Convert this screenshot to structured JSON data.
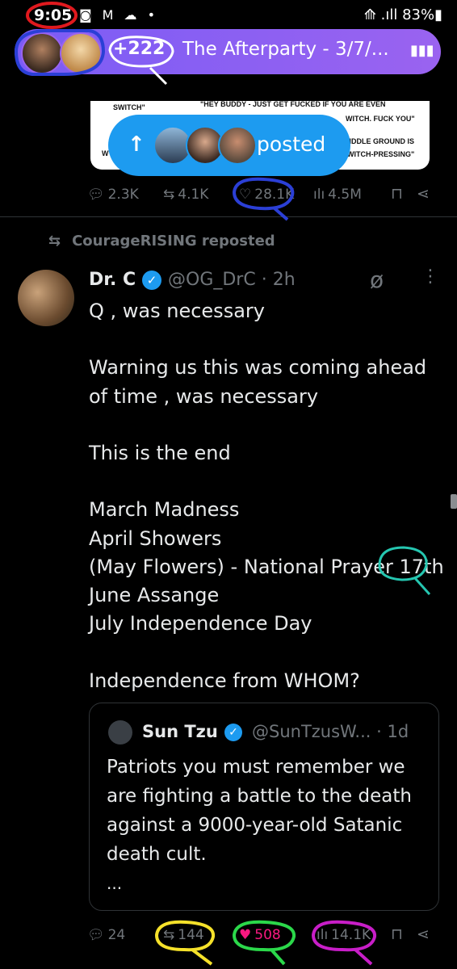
{
  "status_bar": {
    "time": "9:05",
    "icons": "◙ M ☁ •",
    "right": "⟰ .ıll 83%▮"
  },
  "space": {
    "listener_count": "+222",
    "title": "The Afterparty - 3/7/...",
    "audio_icon": "audio-bars-icon"
  },
  "image_card": {
    "line1a": "SWITCH\"",
    "line1b": "\"HEY BUDDY - JUST GET FUCKED IF YOU ARE EVEN",
    "line2": "WITCH. FUCK YOU\"",
    "line3": "IIDDLE GROUND IS",
    "line4a": "W",
    "line4b": "WITCH-PRESSING\""
  },
  "new_posts": {
    "label": "posted",
    "arrow": "↑"
  },
  "prev_actions": {
    "replies": "2.3K",
    "reposts": "4.1K",
    "likes": "28.1K",
    "views": "4.5M"
  },
  "post": {
    "reposted_by": "CourageRISING reposted",
    "author_name": "Dr. C",
    "author_handle": "@OG_DrC · 2h",
    "text": "Q , was necessary\n\nWarning us this was coming ahead\nof time , was necessary\n\nThis is the end\n\nMarch Madness\nApril Showers\n(May Flowers) - National Prayer 17th\nJune Assange\nJuly Independence Day\n\nIndependence from WHOM?",
    "quote": {
      "author_name": "Sun Tzu",
      "author_handle": "@SunTzusW... · 1d",
      "text": "Patriots you must remember we are fighting a battle to the death against a 9000-year-old Satanic death cult.",
      "more": "..."
    },
    "actions": {
      "replies": "24",
      "reposts": "144",
      "likes": "508",
      "views": "14.1K"
    }
  },
  "colors": {
    "accent": "#1d9bf0",
    "like": "#f91880",
    "muted": "#71767b",
    "pill": "#8a5ef4"
  }
}
